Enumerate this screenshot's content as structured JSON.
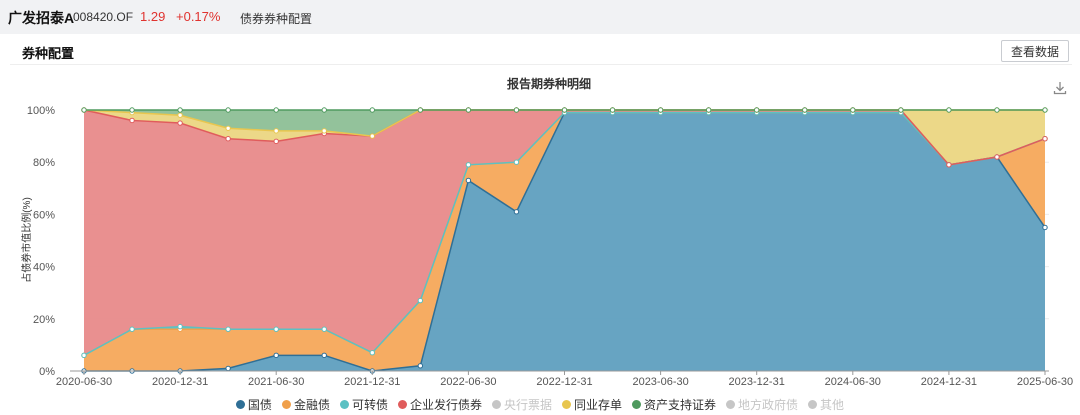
{
  "header": {
    "fund_name": "广发招泰A",
    "fund_code": "008420.OF",
    "price": "1.29",
    "change": "+0.17%",
    "page": "债券券种配置"
  },
  "section": {
    "title": "券种配置",
    "view_data_button": "查看数据"
  },
  "chart_data": {
    "type": "area",
    "stacked": true,
    "title": "报告期券种明细",
    "xlabel": "",
    "ylabel": "占债券市值比例(%)",
    "ylim": [
      0,
      100
    ],
    "y_ticks": [
      "0%",
      "20%",
      "40%",
      "60%",
      "80%",
      "100%"
    ],
    "x": [
      "2020-06-30",
      "2020-09-30",
      "2020-12-31",
      "2021-03-31",
      "2021-06-30",
      "2021-09-30",
      "2021-12-31",
      "2022-03-31",
      "2022-06-30",
      "2022-09-30",
      "2022-12-31",
      "2023-03-31",
      "2023-06-30",
      "2023-09-30",
      "2023-12-31",
      "2024-03-31",
      "2024-06-30",
      "2024-09-30",
      "2024-12-31",
      "2025-03-31",
      "2025-06-30"
    ],
    "x_tick_labels": [
      "2020-06-30",
      "2020-12-31",
      "2021-06-30",
      "2021-12-31",
      "2022-06-30",
      "2022-12-31",
      "2023-06-30",
      "2023-12-31",
      "2024-06-30",
      "2024-12-31",
      "2025-06-30"
    ],
    "series": [
      {
        "name": "国债",
        "color": "#2f6f96",
        "fill": "#5f9fbf",
        "active": true,
        "values": [
          0,
          0,
          0,
          1,
          6,
          6,
          0,
          2,
          73,
          61,
          99,
          99,
          99,
          99,
          99,
          99,
          99,
          99,
          79,
          82,
          55
        ]
      },
      {
        "name": "金融债",
        "color": "#f0a04b",
        "fill": "#f5a85a",
        "active": true,
        "values": [
          6,
          16,
          16,
          15,
          10,
          10,
          7,
          25,
          6,
          19,
          0,
          0,
          0,
          0,
          0,
          0,
          0,
          0,
          0,
          0,
          34
        ]
      },
      {
        "name": "可转债",
        "color": "#5cc1c3",
        "fill": "#5cc1c3",
        "active": true,
        "values": [
          0,
          0,
          1,
          0,
          0,
          0,
          0,
          0,
          0,
          0,
          0,
          0,
          0,
          0,
          0,
          0,
          0,
          0,
          0,
          0,
          0
        ]
      },
      {
        "name": "企业发行债券",
        "color": "#e05c5c",
        "fill": "#e88a8a",
        "active": true,
        "values": [
          94,
          80,
          78,
          73,
          72,
          75,
          83,
          73,
          21,
          20,
          1,
          1,
          1,
          1,
          1,
          1,
          1,
          1,
          0,
          0,
          0
        ]
      },
      {
        "name": "央行票据",
        "color": "#c6c6c6",
        "fill": "#c6c6c6",
        "active": false,
        "values": [
          0,
          0,
          0,
          0,
          0,
          0,
          0,
          0,
          0,
          0,
          0,
          0,
          0,
          0,
          0,
          0,
          0,
          0,
          0,
          0,
          0
        ]
      },
      {
        "name": "同业存单",
        "color": "#e8c64f",
        "fill": "#ebd682",
        "active": true,
        "values": [
          0,
          3,
          3,
          4,
          4,
          1,
          0,
          0,
          0,
          0,
          0,
          0,
          0,
          0,
          0,
          0,
          0,
          0,
          21,
          18,
          11
        ]
      },
      {
        "name": "资产支持证券",
        "color": "#4f9a5f",
        "fill": "#8dbf96",
        "active": true,
        "values": [
          0,
          1,
          2,
          7,
          8,
          8,
          10,
          0,
          0,
          0,
          0,
          0,
          0,
          0,
          0,
          0,
          0,
          0,
          0,
          0,
          0
        ]
      },
      {
        "name": "地方政府债",
        "color": "#c6c6c6",
        "fill": "#c6c6c6",
        "active": false,
        "values": [
          0,
          0,
          0,
          0,
          0,
          0,
          0,
          0,
          0,
          0,
          0,
          0,
          0,
          0,
          0,
          0,
          0,
          0,
          0,
          0,
          0
        ]
      },
      {
        "name": "其他",
        "color": "#c6c6c6",
        "fill": "#c6c6c6",
        "active": false,
        "values": [
          0,
          0,
          0,
          0,
          0,
          0,
          0,
          0,
          0,
          0,
          0,
          0,
          0,
          0,
          0,
          0,
          0,
          0,
          0,
          0,
          0
        ]
      }
    ],
    "grid": true,
    "legend": "bottom"
  }
}
